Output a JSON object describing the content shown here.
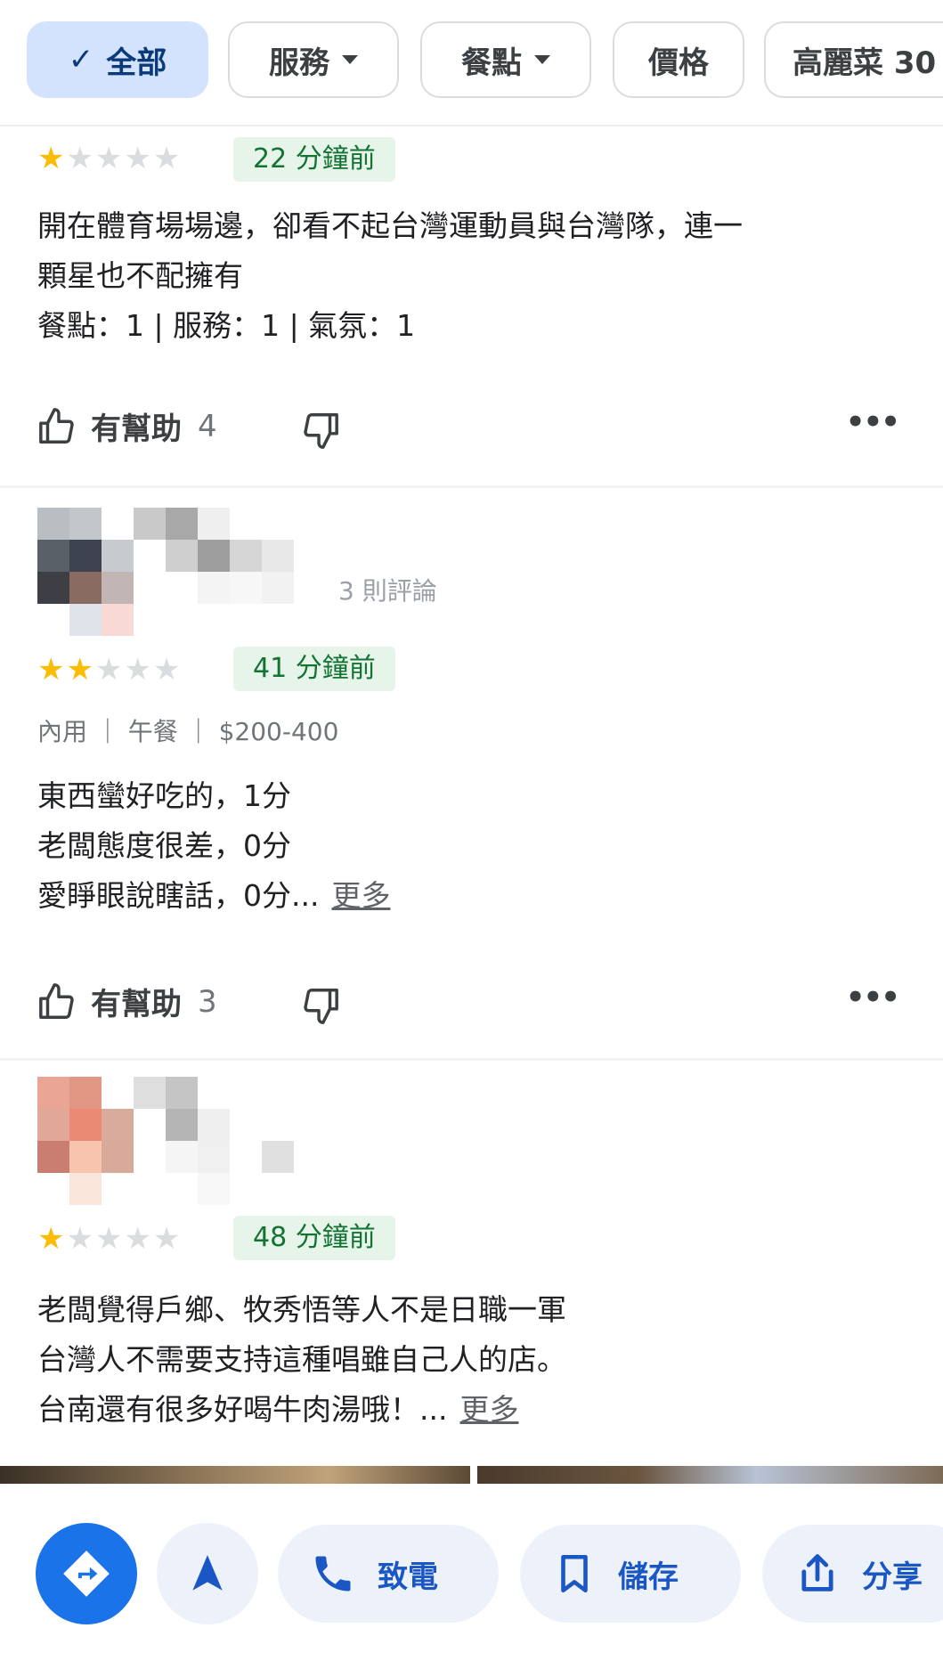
{
  "filters": {
    "chips": [
      {
        "label": "全部",
        "check": "✓",
        "active": true
      },
      {
        "label": "服務",
        "has_dropdown": true
      },
      {
        "label": "餐點",
        "has_dropdown": true
      },
      {
        "label": "價格"
      },
      {
        "label": "高麗菜 30"
      }
    ]
  },
  "reviews": [
    {
      "rating": 1,
      "time": "22 分鐘前",
      "text_lines": [
        "開在體育場場邊，卻看不起台灣運動員與台灣隊，連一",
        "顆星也不配擁有"
      ],
      "sub_ratings": "餐點：1 | 服務：1 | 氣氛：1",
      "helpful_label": "有幫助",
      "helpful_count": "4",
      "more_icon": "three-dots"
    },
    {
      "reviewer_review_count": "3 則評論",
      "rating": 2,
      "time": "41 分鐘前",
      "meta": "內用 ｜ 午餐 ｜ $200-400",
      "text_lines": [
        "東西蠻好吃的，1分",
        "老闆態度很差，0分",
        "愛睜眼說瞎話，0分..."
      ],
      "more_label": "更多",
      "helpful_label": "有幫助",
      "helpful_count": "3",
      "more_icon": "three-dots"
    },
    {
      "rating": 1,
      "time": "48 分鐘前",
      "text_lines": [
        "老闆覺得戶鄉、牧秀悟等人不是日職一軍",
        "台灣人不需要支持這種唱雖自己人的店。",
        "台南還有很多好喝牛肉湯哦！..."
      ],
      "more_label": "更多"
    }
  ],
  "bottom_actions": {
    "directions_icon": "directions-icon",
    "start_icon": "navigation-arrow-icon",
    "call_label": "致電",
    "save_label": "儲存",
    "share_label": "分享"
  },
  "colors": {
    "accent": "#1a73e8",
    "star": "#fbbc04",
    "time_badge_bg": "#e6f4ea",
    "time_badge_text": "#137333",
    "chip_active_bg": "#d3e3fd"
  }
}
